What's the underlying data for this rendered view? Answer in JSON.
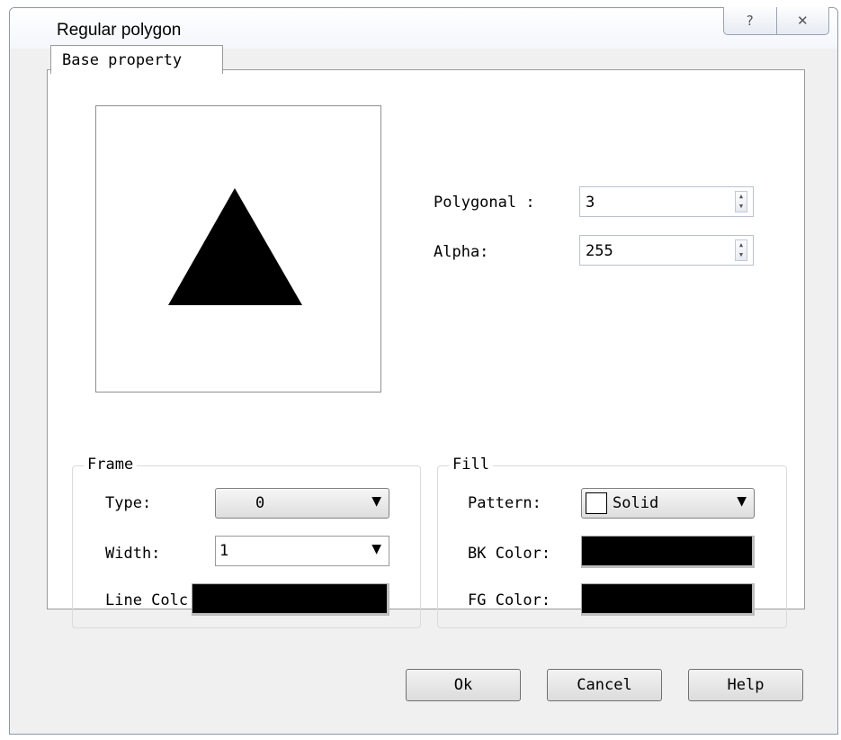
{
  "window": {
    "title": "Regular polygon",
    "help_glyph": "?",
    "close_glyph": "✕"
  },
  "tab": {
    "label": "Base property"
  },
  "preview": {
    "shape": "triangle",
    "fill_color": "#000000"
  },
  "fields": {
    "polygonal": {
      "label": "Polygonal :",
      "value": "3"
    },
    "alpha": {
      "label": "Alpha:",
      "value": "255"
    }
  },
  "frame": {
    "legend": "Frame",
    "type": {
      "label": "Type:",
      "value": "0"
    },
    "width": {
      "label": "Width:",
      "value": "1"
    },
    "line_color": {
      "label": "Line Colc",
      "color": "#000000"
    }
  },
  "fill": {
    "legend": "Fill",
    "pattern": {
      "label": "Pattern:",
      "value": "Solid"
    },
    "bk_color": {
      "label": "BK Color:",
      "color": "#000000"
    },
    "fg_color": {
      "label": "FG Color:",
      "color": "#000000"
    }
  },
  "buttons": {
    "ok": "Ok",
    "cancel": "Cancel",
    "help": "Help"
  },
  "icons": {
    "spin_up": "▲",
    "spin_down": "▼",
    "dropdown": "▼"
  }
}
